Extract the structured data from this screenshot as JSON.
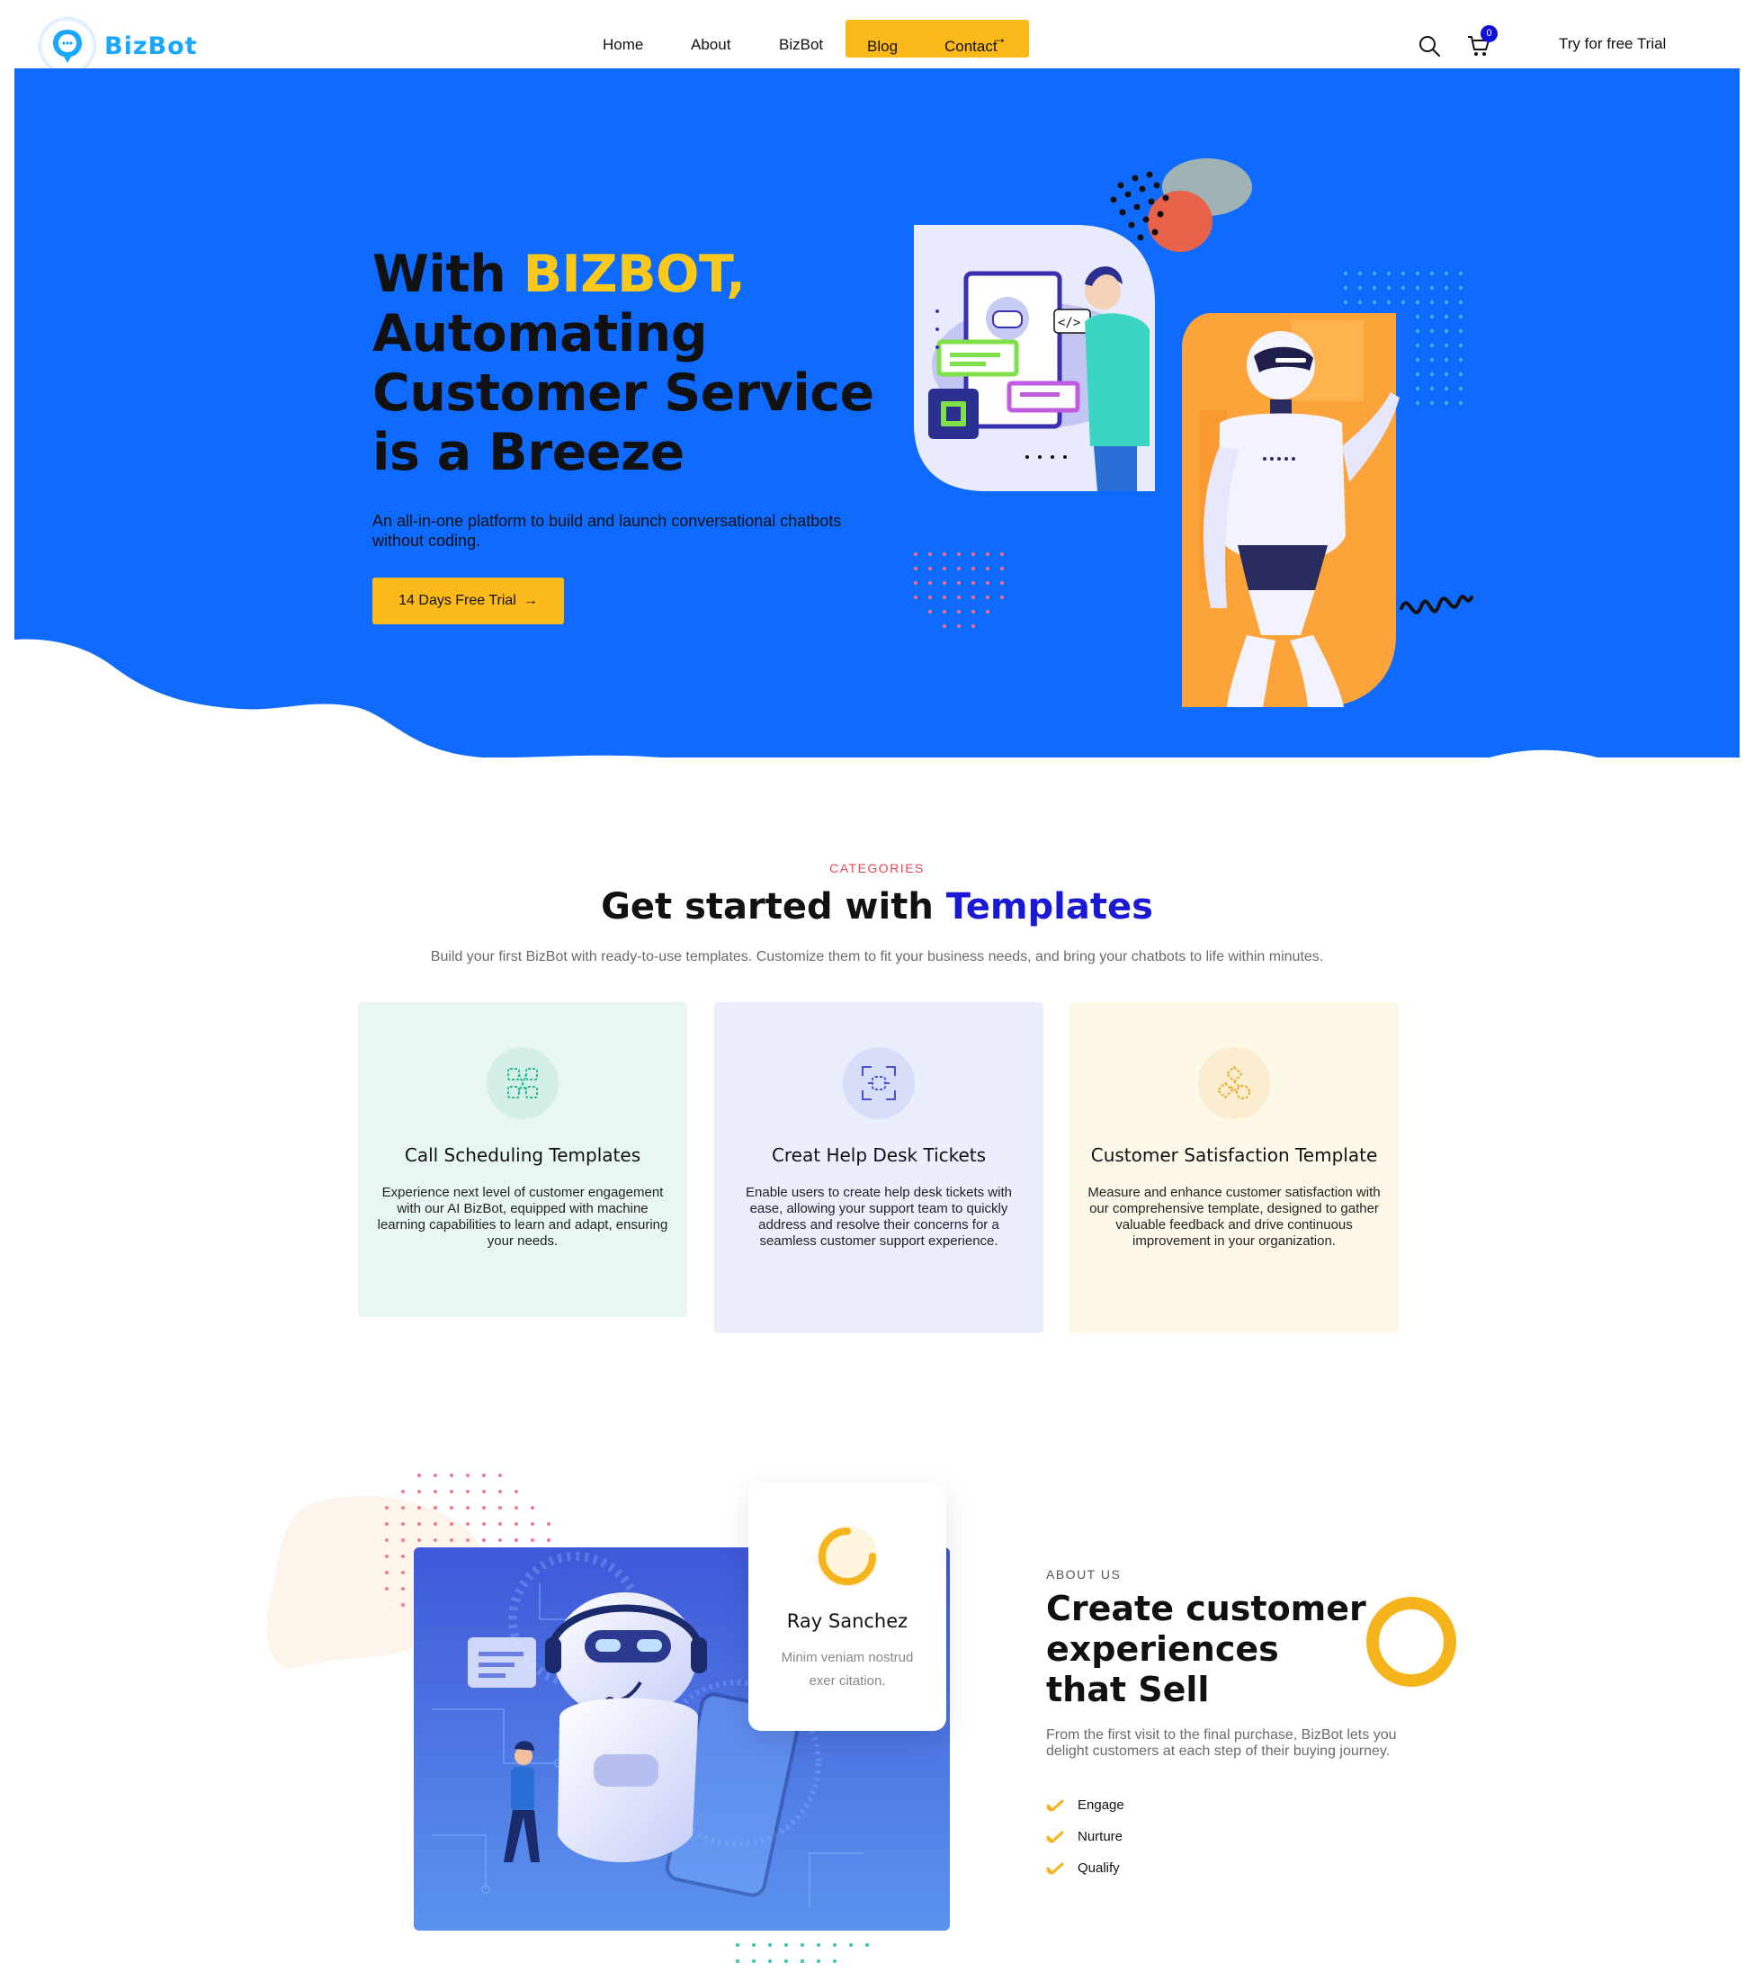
{
  "brand": {
    "name": "BizBot"
  },
  "nav": {
    "items": [
      {
        "label": "Home"
      },
      {
        "label": "About"
      },
      {
        "label": "BizBot"
      },
      {
        "label": "Blog"
      },
      {
        "label": "Contact"
      }
    ],
    "cart_count": "0",
    "trial_link": "Try for free Trial"
  },
  "hero": {
    "title_prefix": "With ",
    "title_accent": "BIZBOT,",
    "title_rest": "Automating Customer Service is a Breeze",
    "subtitle": "An all-in-one platform to build and launch conversational chatbots without coding.",
    "cta": "14 Days Free Trial"
  },
  "categories": {
    "label": "CATEGORIES",
    "title_prefix": "Get started with ",
    "title_accent": "Templates",
    "description": "Build your first BizBot with ready-to-use templates. Customize them to fit your business needs, and bring your chatbots to life within minutes.",
    "cards": [
      {
        "title": "Call Scheduling Templates",
        "text": "Experience next level of customer engagement with our AI BizBot, equipped with machine learning capabilities to learn and adapt, ensuring your needs.",
        "icon": "network-icon"
      },
      {
        "title": "Creat Help Desk Tickets",
        "text": "Enable users to create help desk tickets with ease, allowing your support team to quickly address and resolve their concerns for a seamless customer support experience.",
        "icon": "scan-icon"
      },
      {
        "title": "Customer Satisfaction Template",
        "text": "Measure and enhance customer satisfaction with our comprehensive template, designed to gather valuable feedback and drive continuous improvement in your organization.",
        "icon": "nodes-icon"
      }
    ]
  },
  "about": {
    "label": "ABOUT US",
    "title": "Create customer experiences that Sell",
    "text": "From the first visit to the final purchase, BizBot lets you delight customers at each step of their buying journey.",
    "list": [
      {
        "label": "Engage"
      },
      {
        "label": "Nurture"
      },
      {
        "label": "Qualify"
      }
    ],
    "profile": {
      "name": "Ray Sanchez",
      "text": "Minim veniam nostrud exer citation."
    }
  },
  "colors": {
    "hero_blue": "#0f6bff",
    "accent_yellow": "#fbc91a",
    "button_yellow": "#fbba1a",
    "label_red": "#e8455b",
    "title_blue": "#1a1ad6"
  }
}
